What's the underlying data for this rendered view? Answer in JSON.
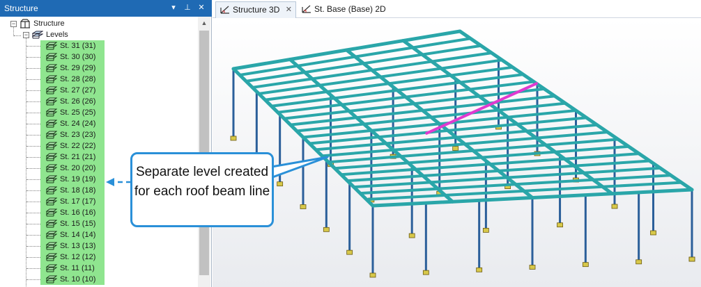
{
  "panel": {
    "title": "Structure",
    "btn_dropdown": "▾",
    "btn_pin": "⊥",
    "btn_close": "✕"
  },
  "tree": {
    "root_label": "Structure",
    "levels_label": "Levels",
    "levels": [
      "St. 31 (31)",
      "St. 30 (30)",
      "St. 29 (29)",
      "St. 28 (28)",
      "St. 27 (27)",
      "St. 26 (26)",
      "St. 25 (25)",
      "St. 24 (24)",
      "St. 23 (23)",
      "St. 22 (22)",
      "St. 21 (21)",
      "St. 20 (20)",
      "St. 19 (19)",
      "St. 18 (18)",
      "St. 17 (17)",
      "St. 16 (16)",
      "St. 15 (15)",
      "St. 14 (14)",
      "St. 13 (13)",
      "St. 12 (12)",
      "St. 11 (11)",
      "St. 10 (10)"
    ]
  },
  "tabs": [
    {
      "label": "Structure 3D",
      "active": true
    },
    {
      "label": "St. Base (Base) 2D",
      "active": false
    }
  ],
  "tab_close": "✕",
  "callout": {
    "text": "Separate level created for each roof beam line"
  },
  "colors": {
    "header_blue": "#1f6ab4",
    "level_highlight": "#8fe58f",
    "beam_cyan": "#2aa6a9",
    "column_blue": "#2b5f9a",
    "highlight_magenta": "#e03ad0",
    "callout_border": "#2a90d8"
  }
}
